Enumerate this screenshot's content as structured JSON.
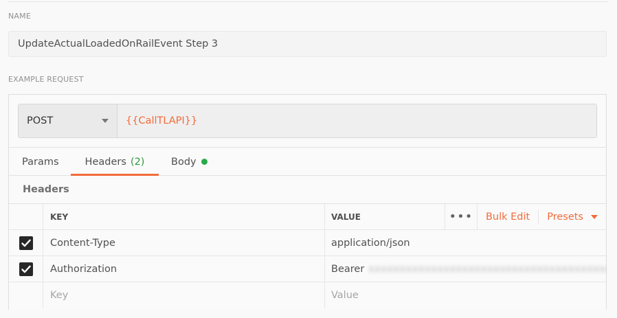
{
  "name_section": {
    "label": "NAME",
    "value": "UpdateActualLoadedOnRailEvent Step 3"
  },
  "example_section": {
    "label": "EXAMPLE REQUEST"
  },
  "request": {
    "method": "POST",
    "url": "{{CallTLAPI}}"
  },
  "tabs": {
    "params": "Params",
    "headers": "Headers",
    "headers_count": "(2)",
    "body": "Body"
  },
  "headers_panel": {
    "title": "Headers",
    "col_key": "KEY",
    "col_value": "VALUE",
    "dots": "•••",
    "bulk_edit": "Bulk Edit",
    "presets": "Presets",
    "rows": [
      {
        "key": "Content-Type",
        "value": "application/json",
        "checked": true
      },
      {
        "key": "Authorization",
        "value": "Bearer",
        "checked": true
      }
    ],
    "key_placeholder": "Key",
    "value_placeholder": "Value"
  },
  "colors": {
    "accent": "#f26b3a",
    "success": "#2aa94a"
  }
}
